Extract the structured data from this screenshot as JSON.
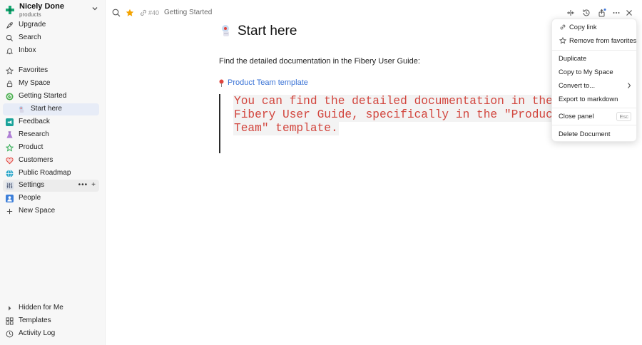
{
  "workspace": {
    "name": "Nicely Done",
    "subtitle": "products"
  },
  "sidebar": {
    "top": [
      {
        "label": "Upgrade",
        "icon": "rocket-icon"
      },
      {
        "label": "Search",
        "icon": "search-icon"
      },
      {
        "label": "Inbox",
        "icon": "bell-icon"
      }
    ],
    "spaces": [
      {
        "label": "Favorites",
        "icon": "star-icon"
      },
      {
        "label": "My Space",
        "icon": "lock-icon"
      },
      {
        "label": "Getting Started",
        "icon": "getting-started-icon"
      },
      {
        "label": "Start here",
        "icon": "doc-page-icon"
      },
      {
        "label": "Feedback",
        "icon": "megaphone-icon"
      },
      {
        "label": "Research",
        "icon": "flask-icon"
      },
      {
        "label": "Product",
        "icon": "star-outline-icon"
      },
      {
        "label": "Customers",
        "icon": "heart-icon"
      },
      {
        "label": "Public Roadmap",
        "icon": "globe-icon"
      },
      {
        "label": "Settings",
        "icon": "sliders-icon"
      },
      {
        "label": "People",
        "icon": "person-icon"
      },
      {
        "label": "New Space",
        "icon": "plus-icon"
      }
    ],
    "settings_actions": {
      "more": "•••",
      "add": "+"
    },
    "bottom": [
      {
        "label": "Hidden for Me",
        "icon": "caret-right-icon"
      },
      {
        "label": "Templates",
        "icon": "templates-icon"
      },
      {
        "label": "Activity Log",
        "icon": "clock-icon"
      }
    ]
  },
  "topbar": {
    "id_text": "#40",
    "breadcrumb": "Getting Started"
  },
  "document": {
    "title": "Start here",
    "paragraph": "Find the detailed documentation in the Fibery User Guide:",
    "link_text": "Product Team template",
    "code_lines": [
      "You can find the detailed documentation in the",
      "Fibery User Guide, specifically in the \"Product",
      "Team\" template."
    ]
  },
  "menu": {
    "items": [
      {
        "label": "Copy link",
        "icon": "link-icon"
      },
      {
        "label": "Remove from favorites",
        "icon": "star-outline-icon"
      },
      {
        "label": "Duplicate"
      },
      {
        "label": "Copy to My Space"
      },
      {
        "label": "Convert to..."
      },
      {
        "label": "Export to markdown"
      },
      {
        "label": "Close panel",
        "shortcut": "Esc"
      },
      {
        "label": "Delete Document"
      }
    ]
  },
  "colors": {
    "accent_link": "#3a73d6",
    "code_red": "#d2453d",
    "favorite_star": "#f4a300",
    "brand_green": "#19a974"
  }
}
